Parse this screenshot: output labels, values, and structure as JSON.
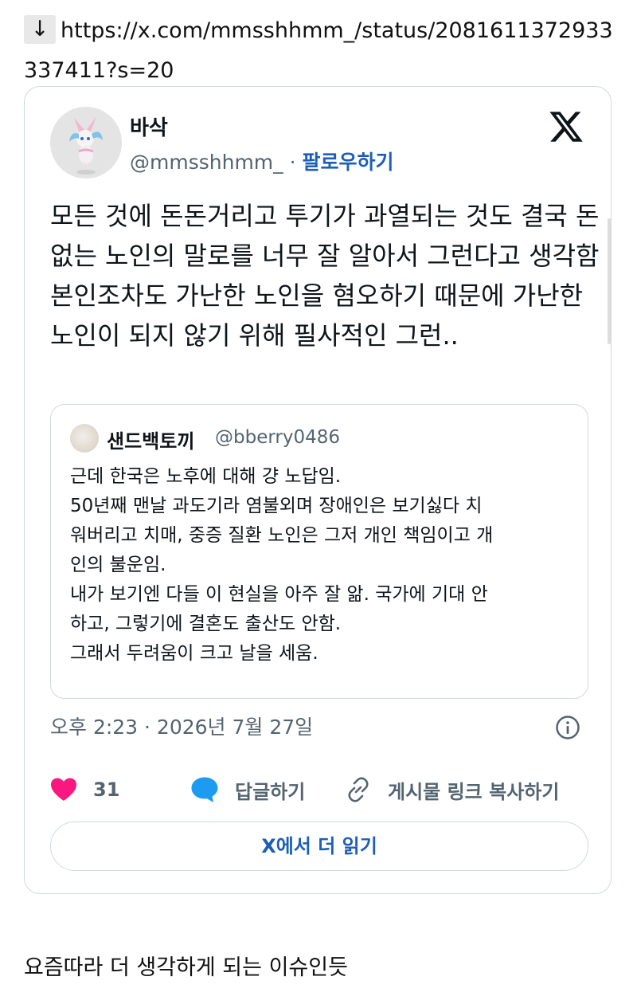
{
  "url_bar": {
    "arrow": "↓",
    "url": "https://x.com/mmsshhmm_/status/2081611372933337411?s=20"
  },
  "tweet": {
    "author_name": "바삭",
    "author_handle": "@mmsshhmm_",
    "separator": "·",
    "follow_label": "팔로우하기",
    "text": "모든 것에 돈돈거리고 투기가 과열되는 것도 결국 돈없는 노인의 말로를 너무 잘 알아서 그런다고 생각함 본인조차도 가난한 노인을 혐오하기 때문에 가난한 노인이 되지 않기 위해 필사적인 그런..",
    "quote": {
      "author_name": "샌드백토끼",
      "author_handle": "@bberry0486",
      "lines": [
        "근데 한국은 노후에 대해 걍 노답임.",
        "50년째 맨날 과도기라 염불외며 장애인은 보기싫다 치",
        "워버리고 치매, 중증 질환 노인은 그저 개인 책임이고 개",
        "인의 불운임.",
        "내가 보기엔 다들 이 현실을 아주 잘 앎. 국가에 기대 안",
        "하고, 그렇기에 결혼도 출산도 안함.",
        "그래서 두려움이 크고 날을 세움."
      ]
    },
    "timestamp": "오후 2:23 · 2026년 7월 27일",
    "like_count": "31",
    "reply_label": "답글하기",
    "copy_link_label": "게시물 링크 복사하기",
    "read_more_label": "X에서 더 읽기"
  },
  "caption": "요즘따라 더 생각하게 되는 이슈인듯",
  "colors": {
    "like": "#f91880",
    "reply": "#1d9bf0",
    "link_text": "#1d5fb8",
    "muted": "#536471",
    "border": "#cfd9de"
  }
}
